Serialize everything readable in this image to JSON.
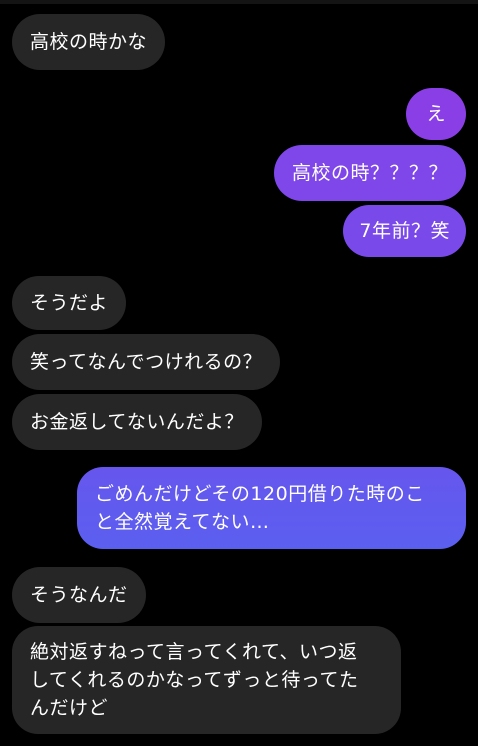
{
  "colors": {
    "background": "#000000",
    "incoming_bubble": "#262626",
    "outgoing_gradient_top": "#8a3fe6",
    "outgoing_gradient_bottom": "#5b5ff0",
    "text": "#ffffff"
  },
  "messages": [
    {
      "sender": "them",
      "text": "高校の時かな"
    },
    {
      "sender": "me",
      "text": "え"
    },
    {
      "sender": "me",
      "text": "高校の時？？？？"
    },
    {
      "sender": "me",
      "text": "7年前？笑"
    },
    {
      "sender": "them",
      "text": "そうだよ"
    },
    {
      "sender": "them",
      "text": "笑ってなんでつけれるの？"
    },
    {
      "sender": "them",
      "text": "お金返してないんだよ？"
    },
    {
      "sender": "me",
      "lines": [
        "ごめんだけどその120円借りた時のこ",
        "と全然覚えてない…"
      ]
    },
    {
      "sender": "them",
      "text": "そうなんだ"
    },
    {
      "sender": "them",
      "lines": [
        "絶対返すねって言ってくれて、いつ返",
        "してくれるのかなってずっと待ってた",
        "んだけど"
      ]
    }
  ]
}
